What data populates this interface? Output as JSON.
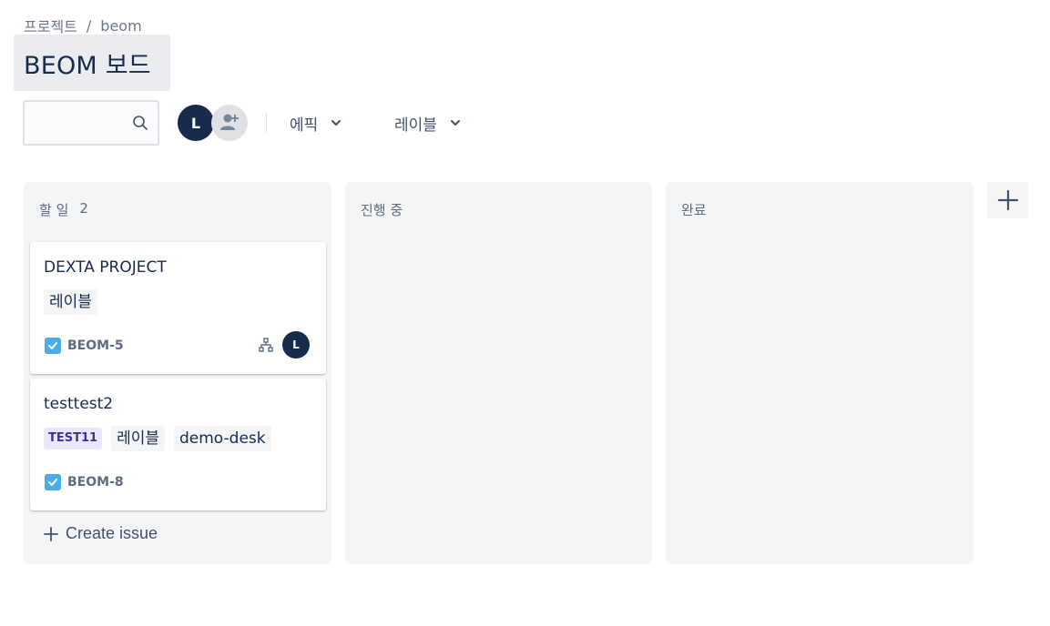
{
  "breadcrumb": {
    "root": "프로젝트",
    "separator": "/",
    "project": "beom"
  },
  "page": {
    "title": "BEOM 보드"
  },
  "toolbar": {
    "search_placeholder": "",
    "avatar_initial": "L",
    "epic_filter": "에픽",
    "label_filter": "레이블"
  },
  "columns": [
    {
      "title": "할 일",
      "count": "2",
      "cards": [
        {
          "title": "DEXTA PROJECT",
          "labels": [
            "레이블"
          ],
          "key": "BEOM-5",
          "assignee": "L"
        },
        {
          "title": "testtest2",
          "epic": "TEST11",
          "labels": [
            "레이블",
            "demo-desk"
          ],
          "key": "BEOM-8"
        }
      ],
      "create_label": "Create issue"
    },
    {
      "title": "진행 중"
    },
    {
      "title": "완료"
    }
  ],
  "colors": {
    "accent": "#172b4d",
    "column_bg": "#f4f5f7",
    "story_check": "#4bade8",
    "epic_bg": "#eae6ff",
    "epic_text": "#403294"
  }
}
